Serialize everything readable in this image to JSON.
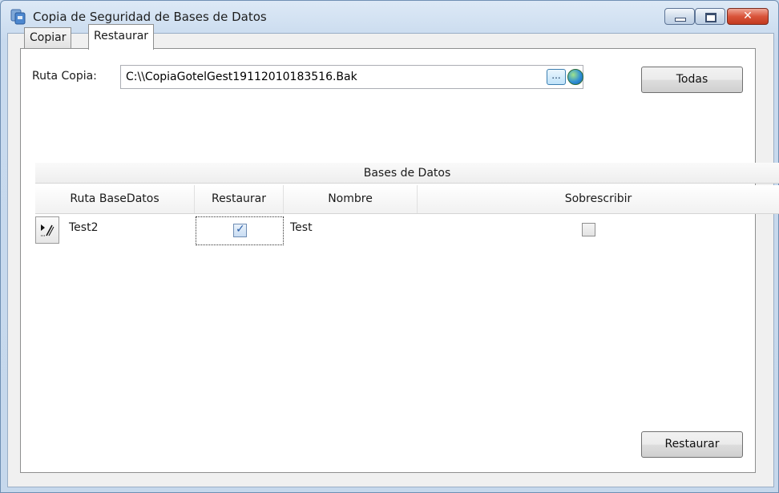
{
  "window": {
    "title": "Copia de Seguridad de Bases de Datos"
  },
  "tabs": [
    {
      "label": "Copiar",
      "active": false
    },
    {
      "label": "Restaurar",
      "active": true
    }
  ],
  "form": {
    "ruta_label": "Ruta Copia:",
    "ruta_value": "C:\\\\CopiaGotelGest19112010183516.Bak",
    "browse_label": "...",
    "todas_label": "Todas"
  },
  "grid": {
    "caption": "Bases de Datos",
    "columns": [
      "Ruta BaseDatos",
      "Restaurar",
      "Nombre",
      "Sobrescribir"
    ],
    "rows": [
      {
        "ruta": "Test2",
        "restaurar": true,
        "nombre": "Test",
        "sobrescribir": false
      }
    ]
  },
  "footer": {
    "restaurar_label": "Restaurar"
  }
}
